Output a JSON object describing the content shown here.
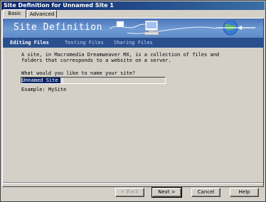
{
  "window": {
    "title": "Site Definition for Unnamed Site 1"
  },
  "tabs": [
    {
      "label": "Basic"
    },
    {
      "label": "Advanced"
    }
  ],
  "banner": {
    "title": "Site Definition"
  },
  "steps": [
    {
      "label": "Editing Files"
    },
    {
      "label": "Testing Files"
    },
    {
      "label": "Sharing Files"
    }
  ],
  "content": {
    "description": "A site, in Macromedia Dreamweaver MX, is a collection of files and folders that corresponds to a website on a server.",
    "question": "What would you like to name your site?",
    "site_name_value": "Unnamed Site 1",
    "example": "Example: MySite"
  },
  "buttons": {
    "back": "< Back",
    "next": "Next >",
    "cancel": "Cancel",
    "help": "Help"
  },
  "colors": {
    "titlebar": "#0a246a",
    "banner": "#5e8bc8",
    "subnav": "#2a4f8f",
    "face": "#d4d0c8"
  },
  "icons": {
    "banner_art": "computer-network-globe-icon"
  }
}
